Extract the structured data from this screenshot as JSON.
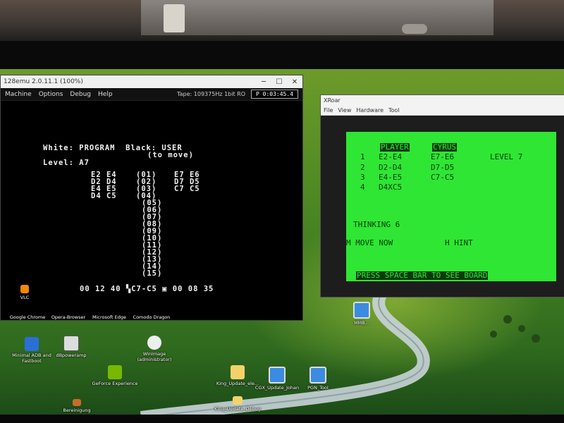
{
  "mame": {
    "title": "128emu 2.0.11.1 (100%)",
    "menu": [
      "Machine",
      "Options",
      "Debug",
      "Help"
    ],
    "tape_status": "Tape: 109375Hz 1bit RO",
    "tape_timer": "P 0:03:45.4",
    "screen": {
      "header_line1": "White: PROGRAM  Black: USER",
      "header_line2": "(to move)",
      "level_line": "Level: A7",
      "moves_white": [
        "E2 E4",
        "D2 D4",
        "E4 E5",
        "D4 C5"
      ],
      "move_numbers": [
        "(01)",
        "(02)",
        "(03)",
        "(04)",
        "(05)",
        "(06)",
        "(07)",
        "(08)",
        "(09)",
        "(10)",
        "(11)",
        "(12)",
        "(13)",
        "(14)",
        "(15)"
      ],
      "moves_black": [
        "E7 E6",
        "D7 D5",
        "C7 C5"
      ],
      "status_line": "00 12 40 ▚C7-C5 ▣ 00 08 35"
    }
  },
  "xroar": {
    "title": "XRoar",
    "menu": [
      "File",
      "View",
      "Hardware",
      "Tool"
    ],
    "screen": {
      "player_label": "PLAYER",
      "cyrus_label": "CYRUS",
      "level_label": "LEVEL 7",
      "rows": [
        {
          "num": "1",
          "player": "E2-E4",
          "cyrus": "E7-E6"
        },
        {
          "num": "2",
          "player": "D2-D4",
          "cyrus": "D7-D5"
        },
        {
          "num": "3",
          "player": "E4-E5",
          "cyrus": "C7-C5"
        },
        {
          "num": "4",
          "player": "D4XC5",
          "cyrus": ""
        }
      ],
      "thinking": "THINKING 6",
      "move_now": "M MOVE NOW",
      "hint": "H HINT",
      "press_space": "PRESS SPACE BAR TO SEE BOARD"
    }
  },
  "desktop_icons": [
    {
      "label": "Google Chrome",
      "icon": "chrome-icon"
    },
    {
      "label": "Opera-Browser",
      "icon": "opera-icon"
    },
    {
      "label": "Microsoft Edge",
      "icon": "edge-icon"
    },
    {
      "label": "Comodo Dragon",
      "icon": "dragon-icon"
    },
    {
      "label": "Minimal ADB and Fastboot",
      "icon": "adb-icon"
    },
    {
      "label": "dBpoweramp",
      "icon": "speaker-icon"
    },
    {
      "label": "WinImage (administrator)",
      "icon": "winimage-icon"
    },
    {
      "label": "GeForce Experience",
      "icon": "geforce-icon"
    },
    {
      "label": "King_Update_ele...",
      "icon": "folder-icon"
    },
    {
      "label": "CGX_Update_Johan",
      "icon": "monitor-icon"
    },
    {
      "label": "PGN_Tool",
      "icon": "monitor-icon"
    },
    {
      "label": "MMB...",
      "icon": "monitor-icon"
    },
    {
      "label": "Bereinigung",
      "icon": "app-icon"
    },
    {
      "label": "King_Update_Debug",
      "icon": "folder-icon"
    },
    {
      "label": "VLC",
      "icon": "vlc-icon"
    }
  ]
}
